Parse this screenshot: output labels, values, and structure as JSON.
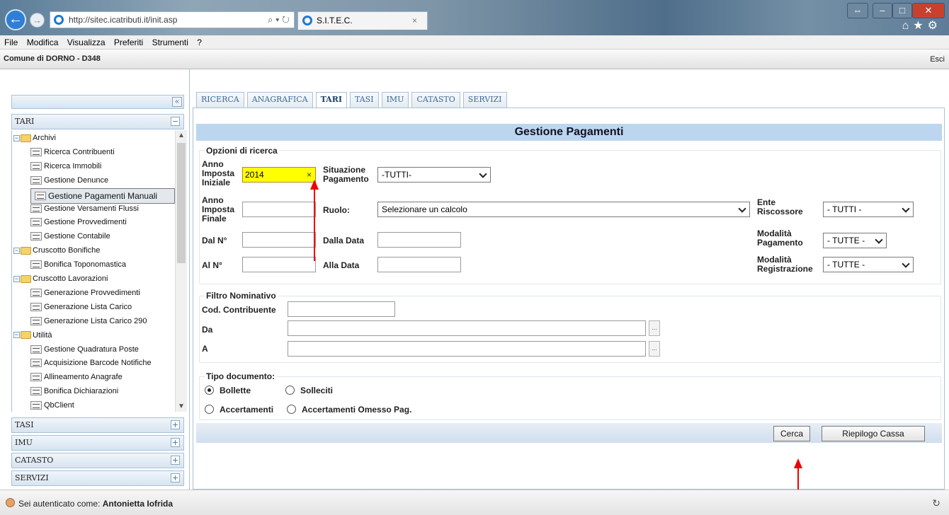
{
  "browser": {
    "url": "http://sitec.icatributi.it/init.asp",
    "tab_title": "S.I.T.E.C.",
    "menu": [
      "File",
      "Modifica",
      "Visualizza",
      "Preferiti",
      "Strumenti",
      "?"
    ]
  },
  "app": {
    "title": "Comune di DORNO - D348",
    "exit_label": "Esci"
  },
  "sidebar": {
    "sections": [
      {
        "label": "TARI",
        "expanded": true
      },
      {
        "label": "TASI",
        "expanded": false
      },
      {
        "label": "IMU",
        "expanded": false
      },
      {
        "label": "CATASTO",
        "expanded": false
      },
      {
        "label": "SERVIZI",
        "expanded": false
      }
    ],
    "tree": [
      {
        "label": "Archivi",
        "type": "folder"
      },
      {
        "label": "Ricerca Contribuenti",
        "type": "item"
      },
      {
        "label": "Ricerca Immobili",
        "type": "item"
      },
      {
        "label": "Gestione Denunce",
        "type": "item"
      },
      {
        "label": "Gestione Pagamenti Manuali",
        "type": "item",
        "selected": true
      },
      {
        "label": "Gestione Versamenti Flussi",
        "type": "item"
      },
      {
        "label": "Gestione Provvedimenti",
        "type": "item"
      },
      {
        "label": "Gestione Contabile",
        "type": "item"
      },
      {
        "label": "Cruscotto Bonifiche",
        "type": "folder"
      },
      {
        "label": "Bonifica Toponomastica",
        "type": "item"
      },
      {
        "label": "Cruscotto Lavorazioni",
        "type": "folder"
      },
      {
        "label": "Generazione Provvedimenti",
        "type": "item"
      },
      {
        "label": "Generazione Lista Carico",
        "type": "item"
      },
      {
        "label": "Generazione Lista Carico 290",
        "type": "item"
      },
      {
        "label": "Utilità",
        "type": "folder"
      },
      {
        "label": "Gestione Quadratura Poste",
        "type": "item"
      },
      {
        "label": "Acquisizione Barcode Notifiche",
        "type": "item"
      },
      {
        "label": "Allineamento Anagrafe",
        "type": "item"
      },
      {
        "label": "Bonifica Dichiarazioni",
        "type": "item"
      },
      {
        "label": "QbClient",
        "type": "item"
      }
    ]
  },
  "tabs": [
    "RICERCA",
    "ANAGRAFICA",
    "TARI",
    "TASI",
    "IMU",
    "CATASTO",
    "SERVIZI"
  ],
  "active_tab": "TARI",
  "page": {
    "title": "Gestione Pagamenti",
    "search_options": {
      "legend": "Opzioni di ricerca",
      "anno_iniziale_label": "Anno Imposta Iniziale",
      "anno_iniziale_value": "2014",
      "situazione_label": "Situazione Pagamento",
      "situazione_value": "-TUTTI-",
      "anno_finale_label": "Anno Imposta Finale",
      "anno_finale_value": "",
      "ruolo_label": "Ruolo:",
      "ruolo_value": "Selezionare un calcolo",
      "ente_label": "Ente Riscossore",
      "ente_value": "- TUTTI -",
      "dal_n_label": "Dal N°",
      "dalla_data_label": "Dalla Data",
      "modalita_pag_label": "Modalità Pagamento",
      "modalita_pag_value": "- TUTTE -",
      "al_n_label": "Al N°",
      "alla_data_label": "Alla Data",
      "modalita_reg_label": "Modalità Registrazione",
      "modalita_reg_value": "- TUTTE -"
    },
    "filter": {
      "legend": "Filtro Nominativo",
      "cod_label": "Cod. Contribuente",
      "da_label": "Da",
      "a_label": "A",
      "browse_label": "..."
    },
    "doc_type": {
      "legend": "Tipo documento:",
      "options": [
        {
          "label": "Bollette",
          "selected": true
        },
        {
          "label": "Solleciti",
          "selected": false
        },
        {
          "label": "Accertamenti",
          "selected": false
        },
        {
          "label": "Accertamenti Omesso Pag.",
          "selected": false
        }
      ]
    },
    "buttons": {
      "search": "Cerca",
      "summary": "Riepilogo Cassa"
    }
  },
  "status": {
    "text_prefix": "Sei autenticato come: ",
    "user": "Antonietta Iofrida"
  },
  "colors": {
    "header_bar": "#bcd6f0",
    "highlight_input": "#ffff00",
    "annotation_arrow": "#e00000"
  }
}
